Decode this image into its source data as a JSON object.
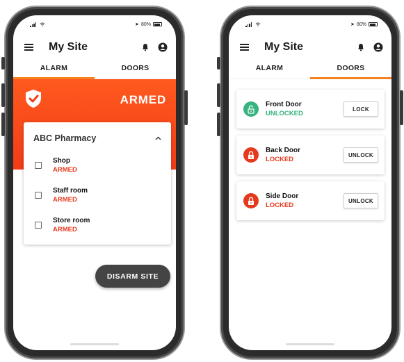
{
  "status_bar": {
    "battery": "80%"
  },
  "app": {
    "title": "My Site"
  },
  "tabs": [
    "ALARM",
    "DOORS"
  ],
  "alarm_screen": {
    "status": "ARMED",
    "site_name": "ABC Pharmacy",
    "rooms": [
      {
        "name": "Shop",
        "state": "ARMED"
      },
      {
        "name": "Staff room",
        "state": "ARMED"
      },
      {
        "name": "Store room",
        "state": "ARMED"
      }
    ],
    "disarm_label": "DISARM SITE"
  },
  "doors_screen": {
    "doors": [
      {
        "name": "Front Door",
        "state": "UNLOCKED",
        "action": "LOCK"
      },
      {
        "name": "Back Door",
        "state": "LOCKED",
        "action": "UNLOCK"
      },
      {
        "name": "Side Door",
        "state": "LOCKED",
        "action": "UNLOCK"
      }
    ]
  },
  "colors": {
    "armed_red": "#e53a1e",
    "unlocked_green": "#36b37e",
    "tab_accent": "#f5821f",
    "hero_orange": "#ff5a1f"
  },
  "icons": [
    "signal-icon",
    "wifi-icon",
    "battery-icon",
    "menu-icon",
    "bell-icon",
    "user-icon",
    "shield-check-icon",
    "chevron-up-icon",
    "lock-open-icon",
    "lock-closed-icon"
  ]
}
